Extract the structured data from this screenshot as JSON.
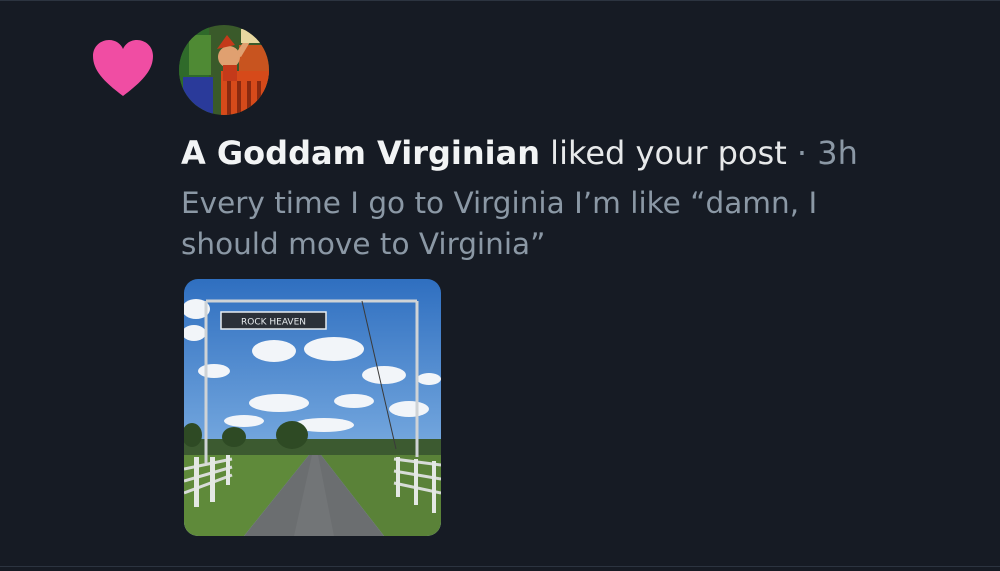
{
  "notification": {
    "type_icon": "heart-icon",
    "colors": {
      "background": "#161b24",
      "heart": "#f04da3",
      "primary_text": "#e7e9ea",
      "secondary_text": "#8b98a5"
    },
    "actor_name": "A Goddam Virginian",
    "action_text": "liked your post",
    "separator": "·",
    "time_ago": "3h",
    "post_text": "Every time I go to Virginia I’m like “damn, I should move to Virginia”",
    "media": {
      "sign_text": "ROCK  HEAVEN"
    }
  }
}
